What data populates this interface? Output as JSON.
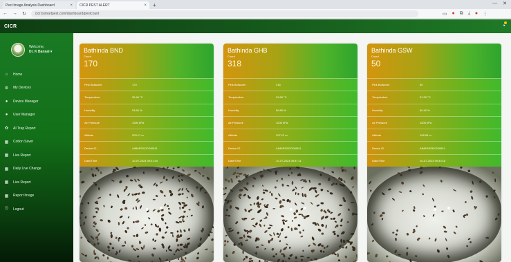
{
  "browser": {
    "tabs": [
      {
        "label": "Pest Image Analysis Dashboard"
      },
      {
        "label": "CICR PEST ALERT"
      }
    ],
    "new_tab_symbol": "+",
    "url": "cicr.bsmartpest.com/dashboard/pestcount"
  },
  "app": {
    "brand": "CICR"
  },
  "sidebar": {
    "welcome": "Welcome,",
    "user": "Dr. K Bansal ▾",
    "items": [
      {
        "label": "Home",
        "icon": "home-icon",
        "glyph": "⌂"
      },
      {
        "label": "My Devices",
        "icon": "devices-icon",
        "glyph": "⚙"
      },
      {
        "label": "Device Manager",
        "icon": "device-manager-icon",
        "glyph": "●"
      },
      {
        "label": "User Manager",
        "icon": "user-manager-icon",
        "glyph": "●"
      },
      {
        "label": "AI Trap Report",
        "icon": "report-icon",
        "glyph": "✿"
      },
      {
        "label": "Cotton Saver",
        "icon": "grid-icon",
        "glyph": "▦"
      },
      {
        "label": "Live Report",
        "icon": "grid-icon",
        "glyph": "▦"
      },
      {
        "label": "Daily Live Change",
        "icon": "grid-icon",
        "glyph": "▦"
      },
      {
        "label": "Live Report",
        "icon": "grid-icon",
        "glyph": "▦"
      },
      {
        "label": "Report Image",
        "icon": "grid-icon",
        "glyph": "▦"
      },
      {
        "label": "Logout",
        "icon": "logout-icon",
        "glyph": "⎋"
      }
    ]
  },
  "cards": [
    {
      "title": "Bathinda BND",
      "subtitle": "Count",
      "count": "170",
      "rows": [
        {
          "k": "Pink Bollworm",
          "v": "170"
        },
        {
          "k": "Temperature",
          "v": "30.40 °C"
        },
        {
          "k": "Humidity",
          "v": "53.60 %"
        },
        {
          "k": "Air Pressure",
          "v": "1000 hPa"
        },
        {
          "k": "Altitude",
          "v": "203.17 m"
        },
        {
          "k": "Device ID",
          "v": "AIMAP00120240811"
        },
        {
          "k": "Date/Time",
          "v": "10-07-2024 09:41:04"
        }
      ]
    },
    {
      "title": "Bathinda GHB",
      "subtitle": "Count",
      "count": "318",
      "rows": [
        {
          "k": "Pink Bollworm",
          "v": "318"
        },
        {
          "k": "Temperature",
          "v": "29.60 °C"
        },
        {
          "k": "Humidity",
          "v": "56.80 %"
        },
        {
          "k": "Air Pressure",
          "v": "1000 hPa"
        },
        {
          "k": "Altitude",
          "v": "207.12 m"
        },
        {
          "k": "Device ID",
          "v": "AIMAP00220240811"
        },
        {
          "k": "Date/Time",
          "v": "10-07-2024 09:37:11"
        }
      ]
    },
    {
      "title": "Bathinda GSW",
      "subtitle": "Count",
      "count": "50",
      "rows": [
        {
          "k": "Pink Bollworm",
          "v": "50"
        },
        {
          "k": "Temperature",
          "v": "31.20 °C"
        },
        {
          "k": "Humidity",
          "v": "50.40 %"
        },
        {
          "k": "Air Pressure",
          "v": "1000 hPa"
        },
        {
          "k": "Altitude",
          "v": "198.05 m"
        },
        {
          "k": "Device ID",
          "v": "AIMAP00320240811"
        },
        {
          "k": "Date/Time",
          "v": "10-07-2024 09:40:16"
        }
      ]
    }
  ]
}
